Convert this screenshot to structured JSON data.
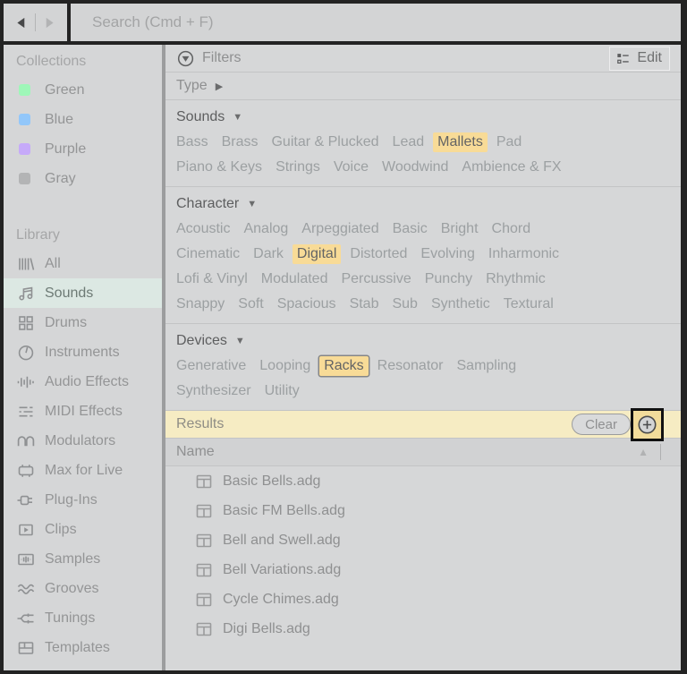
{
  "topbar": {
    "search_placeholder": "Search (Cmd + F)",
    "back_icon": "back-arrow",
    "forward_icon": "forward-arrow"
  },
  "sidebar": {
    "collections": {
      "title": "Collections",
      "items": [
        {
          "label": "Green",
          "color": "#9ef7b8"
        },
        {
          "label": "Blue",
          "color": "#92c7fa"
        },
        {
          "label": "Purple",
          "color": "#c6aaf9"
        },
        {
          "label": "Gray",
          "color": "#b3b4b5"
        }
      ]
    },
    "library": {
      "title": "Library",
      "items": [
        {
          "label": "All",
          "icon": "all-icon",
          "selected": false
        },
        {
          "label": "Sounds",
          "icon": "sounds-icon",
          "selected": true
        },
        {
          "label": "Drums",
          "icon": "drums-icon",
          "selected": false
        },
        {
          "label": "Instruments",
          "icon": "instruments-icon",
          "selected": false
        },
        {
          "label": "Audio Effects",
          "icon": "audio-effects-icon",
          "selected": false
        },
        {
          "label": "MIDI Effects",
          "icon": "midi-effects-icon",
          "selected": false
        },
        {
          "label": "Modulators",
          "icon": "modulators-icon",
          "selected": false
        },
        {
          "label": "Max for Live",
          "icon": "max-for-live-icon",
          "selected": false
        },
        {
          "label": "Plug-Ins",
          "icon": "plug-ins-icon",
          "selected": false
        },
        {
          "label": "Clips",
          "icon": "clips-icon",
          "selected": false
        },
        {
          "label": "Samples",
          "icon": "samples-icon",
          "selected": false
        },
        {
          "label": "Grooves",
          "icon": "grooves-icon",
          "selected": false
        },
        {
          "label": "Tunings",
          "icon": "tunings-icon",
          "selected": false
        },
        {
          "label": "Templates",
          "icon": "templates-icon",
          "selected": false
        }
      ]
    }
  },
  "main": {
    "filters_title": "Filters",
    "edit_label": "Edit",
    "sections": [
      {
        "id": "type",
        "label": "Type",
        "arrow": "▶",
        "lines": []
      },
      {
        "id": "sounds",
        "label": "Sounds",
        "arrow": "▼",
        "lines": [
          [
            {
              "label": "Bass"
            },
            {
              "label": "Brass"
            },
            {
              "label": "Guitar & Plucked"
            },
            {
              "label": "Lead"
            },
            {
              "label": "Mallets",
              "active": true
            },
            {
              "label": "Pad"
            }
          ],
          [
            {
              "label": "Piano & Keys"
            },
            {
              "label": "Strings"
            },
            {
              "label": "Voice"
            },
            {
              "label": "Woodwind"
            },
            {
              "label": "Ambience & FX"
            }
          ]
        ]
      },
      {
        "id": "character",
        "label": "Character",
        "arrow": "▼",
        "lines": [
          [
            {
              "label": "Acoustic"
            },
            {
              "label": "Analog"
            },
            {
              "label": "Arpeggiated"
            },
            {
              "label": "Basic"
            },
            {
              "label": "Bright"
            },
            {
              "label": "Chord"
            }
          ],
          [
            {
              "label": "Cinematic"
            },
            {
              "label": "Dark"
            },
            {
              "label": "Digital",
              "active": true
            },
            {
              "label": "Distorted"
            },
            {
              "label": "Evolving"
            },
            {
              "label": "Inharmonic"
            }
          ],
          [
            {
              "label": "Lofi & Vinyl"
            },
            {
              "label": "Modulated"
            },
            {
              "label": "Percussive"
            },
            {
              "label": "Punchy"
            },
            {
              "label": "Rhythmic"
            }
          ],
          [
            {
              "label": "Snappy"
            },
            {
              "label": "Soft"
            },
            {
              "label": "Spacious"
            },
            {
              "label": "Stab"
            },
            {
              "label": "Sub"
            },
            {
              "label": "Synthetic"
            },
            {
              "label": "Textural"
            }
          ]
        ]
      },
      {
        "id": "devices",
        "label": "Devices",
        "arrow": "▼",
        "lines": [
          [
            {
              "label": "Generative"
            },
            {
              "label": "Looping"
            },
            {
              "label": "Racks",
              "active": true,
              "focused": true
            },
            {
              "label": "Resonator"
            },
            {
              "label": "Sampling"
            }
          ],
          [
            {
              "label": "Synthesizer"
            },
            {
              "label": "Utility"
            }
          ]
        ]
      }
    ],
    "results": {
      "title": "Results",
      "clear_label": "Clear",
      "add_icon": "plus-icon"
    },
    "table": {
      "name_header": "Name",
      "sort_icon": "sort-ascending",
      "rows": [
        {
          "name": "Basic Bells.adg",
          "icon": "rack-icon"
        },
        {
          "name": "Basic FM Bells.adg",
          "icon": "rack-icon"
        },
        {
          "name": "Bell and Swell.adg",
          "icon": "rack-icon"
        },
        {
          "name": "Bell Variations.adg",
          "icon": "rack-icon"
        },
        {
          "name": "Cycle Chimes.adg",
          "icon": "rack-icon"
        },
        {
          "name": "Digi Bells.adg",
          "icon": "rack-icon"
        }
      ]
    }
  },
  "colors": {
    "frame": "#232323",
    "panel": "#d6d7d8",
    "selected_row": "#dce8e3",
    "tag_highlight": "#f8db97",
    "results_bar": "#f6ecc3",
    "plus_button_bg": "#f2dc9b",
    "focus_border": "#111111"
  }
}
